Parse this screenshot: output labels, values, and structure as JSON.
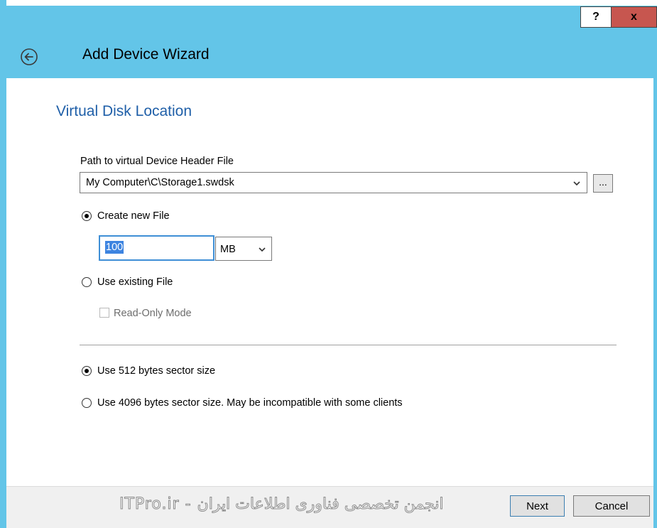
{
  "window": {
    "title": "Add Device Wizard",
    "help_label": "?",
    "close_label": "x",
    "accent_color": "#63c5e8"
  },
  "page": {
    "section_title": "Virtual Disk Location",
    "path_label": "Path to virtual Device Header File",
    "path_value": "My Computer\\C\\Storage1.swdsk",
    "browse_label": "...",
    "create_new_label": "Create new File",
    "size_value": "100",
    "unit_value": "MB",
    "use_existing_label": "Use existing File",
    "readonly_label": "Read-Only Mode",
    "sector512_label": "Use 512 bytes sector size",
    "sector4096_label": "Use 4096 bytes sector size. May be incompatible with some clients"
  },
  "state": {
    "create_new_selected": true,
    "use_existing_selected": false,
    "readonly_checked": false,
    "sector512_selected": true,
    "sector4096_selected": false
  },
  "footer": {
    "watermark": "ITPro.ir - انجمن تخصصی فناوری اطلاعات ایران",
    "next_label": "Next",
    "cancel_label": "Cancel"
  }
}
